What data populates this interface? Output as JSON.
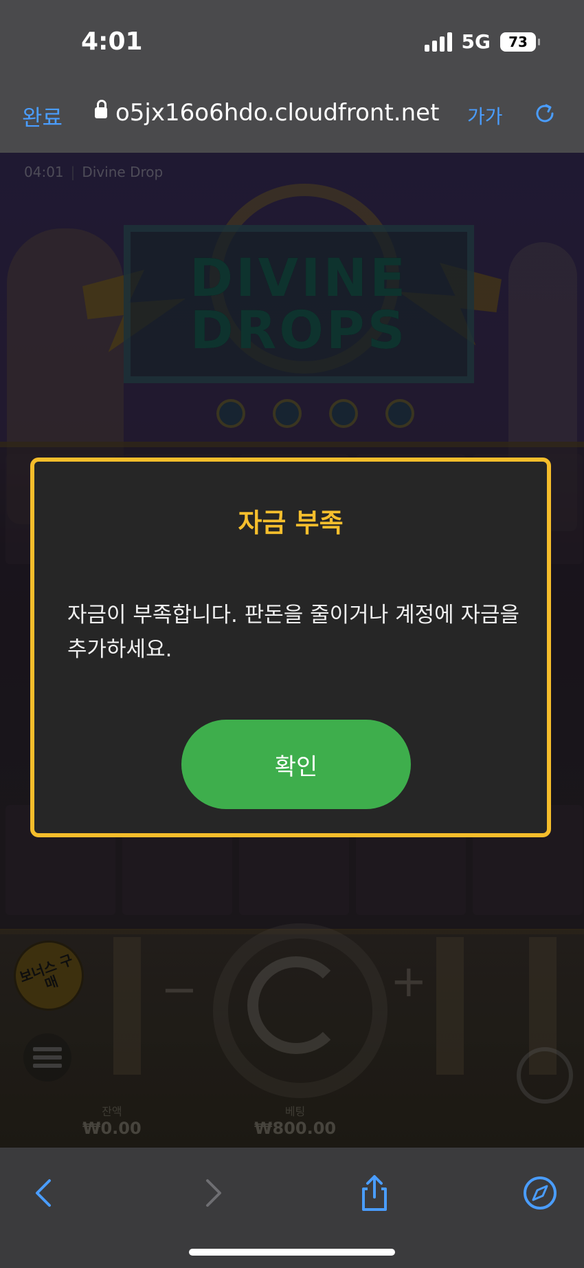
{
  "status_bar": {
    "time": "4:01",
    "network": "5G",
    "battery": "73"
  },
  "browser": {
    "done_label": "완료",
    "url": "o5jx16o6hdo.cloudfront.net",
    "text_size_label": "가가"
  },
  "game": {
    "clock": "04:01",
    "title": "Divine Drop",
    "logo_line1": "DIVINE",
    "logo_line2": "DROPS",
    "bonus_label": "보너스 구매",
    "minus_label": "−",
    "plus_label": "+",
    "balance_label": "잔액",
    "balance_value": "₩0.00",
    "bet_label": "베팅",
    "bet_value": "₩800.00"
  },
  "modal": {
    "title": "자금 부족",
    "message": "자금이 부족합니다. 판돈을 줄이거나 계정에 자금을 추가하세요.",
    "confirm_label": "확인",
    "border_color": "#f5bd2b",
    "button_color": "#3eae4c"
  }
}
